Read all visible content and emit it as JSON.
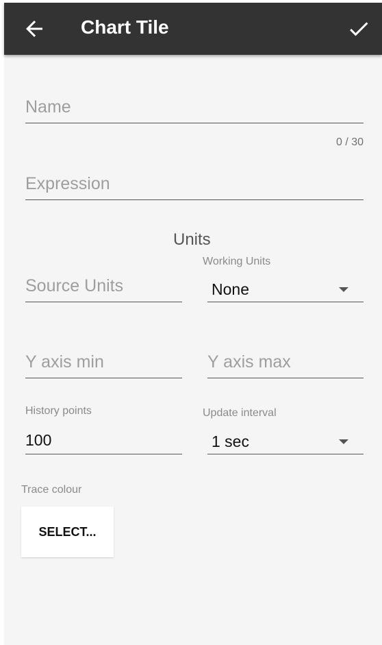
{
  "app_bar": {
    "title": "Chart Tile"
  },
  "form": {
    "name": {
      "placeholder": "Name",
      "counter": "0 / 30"
    },
    "expression": {
      "placeholder": "Expression"
    },
    "units_heading": "Units",
    "source_units": {
      "placeholder": "Source Units"
    },
    "working_units": {
      "label": "Working Units",
      "selected": "None"
    },
    "y_axis_min": {
      "placeholder": "Y axis min"
    },
    "y_axis_max": {
      "placeholder": "Y axis max"
    },
    "history_points": {
      "label": "History points",
      "value": "100"
    },
    "update_interval": {
      "label": "Update interval",
      "selected": "1 sec"
    },
    "trace_colour": {
      "label": "Trace colour",
      "button": "SELECT..."
    }
  },
  "colors": {
    "app_bar": "#333333",
    "background": "#f5f5f5"
  },
  "icons": {
    "back": "arrow-back-icon",
    "confirm": "check-icon"
  }
}
